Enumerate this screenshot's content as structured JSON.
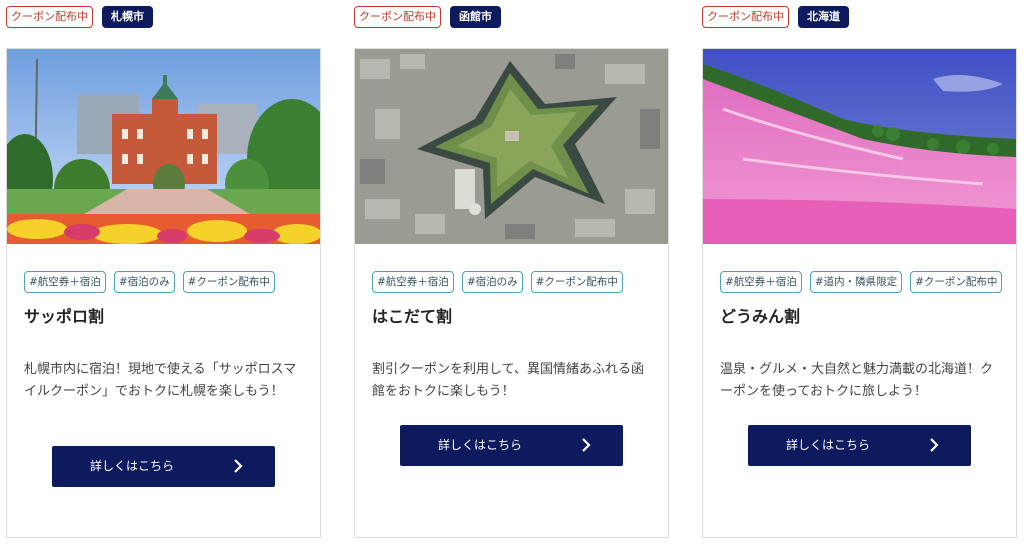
{
  "cards": [
    {
      "coupon_badge": "クーポン配布中",
      "city_badge": "札幌市",
      "tags": [
        "#航空券＋宿泊",
        "#宿泊のみ",
        "#クーポン配布中"
      ],
      "title": "サッポロ割",
      "description": "札幌市内に宿泊！現地で使える「サッポロスマイルクーポン」でおトクに札幌を楽しもう！",
      "button_label": "詳しくはこちら",
      "icon": "chevron-right-icon"
    },
    {
      "coupon_badge": "クーポン配布中",
      "city_badge": "函館市",
      "tags": [
        "#航空券＋宿泊",
        "#宿泊のみ",
        "#クーポン配布中"
      ],
      "title": "はこだて割",
      "description": "割引クーポンを利用して、異国情緒あふれる函館をおトクに楽しもう！",
      "button_label": "詳しくはこちら",
      "icon": "chevron-right-icon"
    },
    {
      "coupon_badge": "クーポン配布中",
      "city_badge": "北海道",
      "tags": [
        "#航空券＋宿泊",
        "#道内・隣県限定",
        "#クーポン配布中"
      ],
      "title": "どうみん割",
      "description": "温泉・グルメ・大自然と魅力満載の北海道！クーポンを使っておトクに旅しよう！",
      "button_label": "詳しくはこちら",
      "icon": "chevron-right-icon"
    }
  ],
  "colors": {
    "navy": "#0d1b5e",
    "coupon_red": "#c23b2e",
    "tag_teal": "#4fa3b5"
  }
}
